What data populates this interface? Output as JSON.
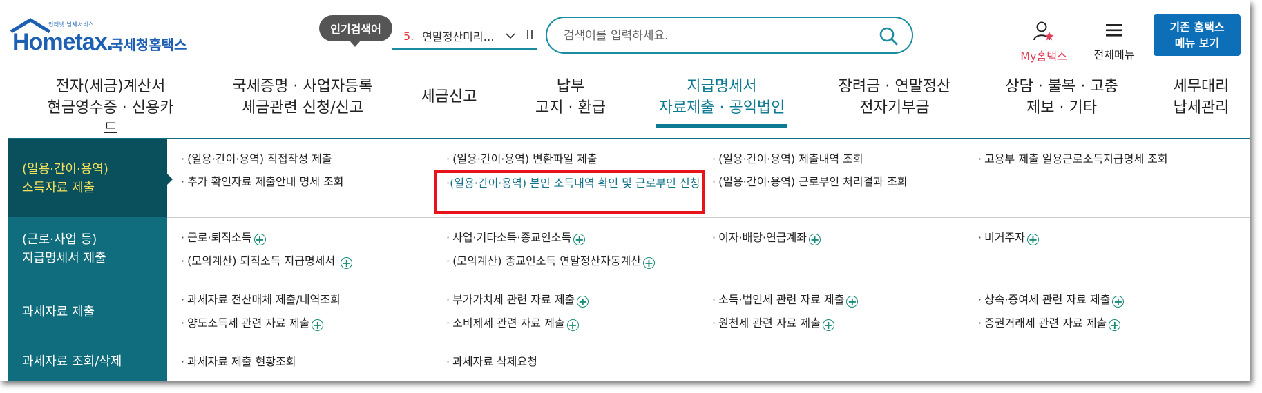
{
  "header": {
    "logo_small": "인터넷 납세서비스",
    "logo_word": "Hometax.",
    "logo_kor": "국세청홈택스",
    "popular_badge": "인기검색어",
    "popular_rank": "5.",
    "popular_text": "연말정산미리…",
    "search_placeholder": "검색어를 입력하세요.",
    "my_label": "My홈택스",
    "allmenu_label": "전체메뉴",
    "legacy_line1": "기존 홈택스",
    "legacy_line2": "메뉴 보기",
    "colors": {
      "brand": "#1d5fb3",
      "accent": "#0d7a93",
      "highlight": "#e8141c"
    }
  },
  "gnb": [
    {
      "line1": "전자(세금)계산서",
      "line2": "현금영수증 · 신용카드"
    },
    {
      "line1": "국세증명 · 사업자등록",
      "line2": "세금관련 신청/신고"
    },
    {
      "line1": "세금신고",
      "line2": ""
    },
    {
      "line1": "납부",
      "line2": "고지 · 환급"
    },
    {
      "line1": "지급명세서",
      "line2": "자료제출 · 공익법인"
    },
    {
      "line1": "장려금 · 연말정산",
      "line2": "전자기부금"
    },
    {
      "line1": "상담 · 불복 · 고충",
      "line2": "제보 · 기타"
    },
    {
      "line1": "세무대리",
      "line2": "납세관리"
    }
  ],
  "rows": [
    {
      "head_line1": "(일용·간이·용역)",
      "head_line2": "소득자료 제출",
      "links": [
        "(일용·간이·용역) 직접작성 제출",
        "(일용·간이·용역) 변환파일 제출",
        "(일용·간이·용역) 제출내역 조회",
        "고용부 제출 일용근로소득지급명세 조회",
        "추가 확인자료 제출안내 명세 조회",
        "(일용·간이·용역) 본인 소득내역 확인 및 근로부인 신청",
        "(일용·간이·용역) 근로부인 처리결과 조회"
      ]
    },
    {
      "head_line1": "(근로·사업 등)",
      "head_line2": "지급명세서 제출",
      "links": [
        "근로·퇴직소득",
        "사업·기타소득·종교인소득",
        "이자·배당·연금계좌",
        "비거주자",
        "(모의계산) 퇴직소득 지급명세서",
        "(모의계산) 종교인소득 연말정산자동계산"
      ]
    },
    {
      "head_line1": "과세자료 제출",
      "links": [
        "과세자료 전산매체 제출/내역조회",
        "부가가치세 관련 자료 제출",
        "소득·법인세 관련 자료 제출",
        "상속·증여세 관련 자료 제출",
        "양도소득세 관련 자료 제출",
        "소비제세 관련 자료 제출",
        "원천세 관련 자료 제출",
        "증권거래세 관련 자료 제출"
      ]
    },
    {
      "head_line1": "과세자료 조회/삭제",
      "links": [
        "과세자료 제출 현황조회",
        "과세자료 삭제요청"
      ]
    }
  ]
}
